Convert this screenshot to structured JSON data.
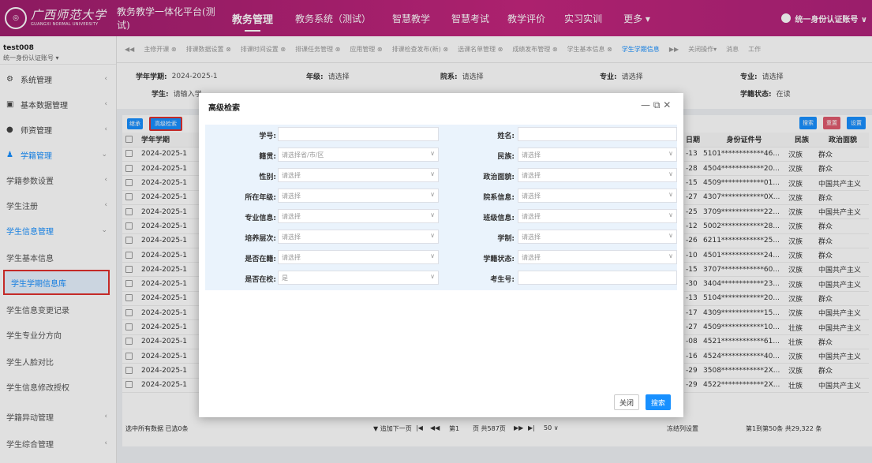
{
  "brand": {
    "name_cn": "广西师范大学",
    "name_en": "GUANGXI NORMAL UNIVERSITY",
    "system": "教务教学一体化平台(测试)"
  },
  "nav": [
    "教务管理",
    "教务系统（测试）",
    "智慧教学",
    "智慧考试",
    "教学评价",
    "实习实训",
    "更多 ▾"
  ],
  "user": "统一身份认证账号 ∨",
  "sidebar": {
    "account": "test008",
    "account_sub": "统一身份认证账号 ▾",
    "items": [
      "系统管理",
      "基本数据管理",
      "师资管理",
      "学籍管理",
      "学籍参数设置",
      "学生注册",
      "学生信息管理",
      "学生基本信息",
      "学生学期信息库",
      "学生信息变更记录",
      "学生专业分方向",
      "学生人脸对比",
      "学生信息修改授权",
      "学籍异动管理",
      "学生综合管理"
    ]
  },
  "tabs": [
    "◀◀",
    "主修开课 ⊗",
    "排课数据设置 ⊗",
    "排课时间设置 ⊗",
    "排课任务管理 ⊗",
    "应用管理 ⊗",
    "排课检查发布(新) ⊗",
    "选课名单管理 ⊗",
    "成绩发布管理 ⊗",
    "学生基本信息 ⊗",
    "学生学期信息",
    "▶▶",
    "关闭操作▾",
    "消息",
    "工作"
  ],
  "filters": {
    "term_label": "学年学期:",
    "term_value": "2024-2025-1",
    "grade_label": "年级:",
    "grade_value": "请选择",
    "dept_label": "院系:",
    "dept_value": "请选择",
    "major_label": "专业:",
    "major_value": "请选择",
    "major2_label": "专业:",
    "major2_value": "请选择",
    "student_label": "学生:",
    "student_value": "请输入学",
    "status_label": "学籍状态:",
    "status_value": "在读"
  },
  "toolbar": {
    "b1": "继承",
    "b2": "高级检索",
    "search": "搜索",
    "reset": "重置",
    "settings": "设置"
  },
  "table": {
    "h_term": "学年学期",
    "h_date": "日期",
    "h_id": "身份证件号",
    "h_nation": "民族",
    "h_party": "政治面貌",
    "rows": [
      [
        "2024-2025-1",
        "-13",
        "5101************46...",
        "汉族",
        "群众"
      ],
      [
        "2024-2025-1",
        "-28",
        "4504************20...",
        "汉族",
        "群众"
      ],
      [
        "2024-2025-1",
        "-15",
        "4509************01...",
        "汉族",
        "中国共产主义"
      ],
      [
        "2024-2025-1",
        "-27",
        "4307************0X...",
        "汉族",
        "群众"
      ],
      [
        "2024-2025-1",
        "-25",
        "3709************22...",
        "汉族",
        "中国共产主义"
      ],
      [
        "2024-2025-1",
        "-12",
        "5002************28...",
        "汉族",
        "群众"
      ],
      [
        "2024-2025-1",
        "-26",
        "6211************25...",
        "汉族",
        "群众"
      ],
      [
        "2024-2025-1",
        "-10",
        "4501************24...",
        "汉族",
        "群众"
      ],
      [
        "2024-2025-1",
        "-15",
        "3707************60...",
        "汉族",
        "中国共产主义"
      ],
      [
        "2024-2025-1",
        "-30",
        "3404************23...",
        "汉族",
        "中国共产主义"
      ],
      [
        "2024-2025-1",
        "-13",
        "5104************20...",
        "汉族",
        "群众"
      ],
      [
        "2024-2025-1",
        "-17",
        "4309************15...",
        "汉族",
        "中国共产主义"
      ],
      [
        "2024-2025-1",
        "-27",
        "4509************10...",
        "壮族",
        "中国共产主义"
      ],
      [
        "2024-2025-1",
        "-08",
        "4521************61...",
        "壮族",
        "群众"
      ],
      [
        "2024-2025-1",
        "-16",
        "4524************40...",
        "汉族",
        "中国共产主义"
      ],
      [
        "2024-2025-1",
        "-29",
        "3508************2X...",
        "汉族",
        "群众"
      ],
      [
        "2024-2025-1",
        "-29",
        "4522************2X...",
        "壮族",
        "中国共产主义"
      ]
    ]
  },
  "pager": {
    "select_all": "选中所有数据 已选0条",
    "load_next": "▼ 追加下一页",
    "first": "|◀",
    "prev": "◀◀",
    "page_pre": "第1",
    "page_total": "页 共587页",
    "next": "▶▶",
    "last": "▶|",
    "size": "50 ∨",
    "freeze": "冻结列设置",
    "summary": "第1到第50条 共29,322 条"
  },
  "modal": {
    "title": "高级检索",
    "controls": "— ⧉ ✕",
    "fields": [
      {
        "label": "学号:",
        "value": ""
      },
      {
        "label": "姓名:",
        "value": ""
      },
      {
        "label": "籍贯:",
        "value": "请选择省/市/区"
      },
      {
        "label": "民族:",
        "value": "请选择"
      },
      {
        "label": "性别:",
        "value": "请选择"
      },
      {
        "label": "政治面貌:",
        "value": "请选择"
      },
      {
        "label": "所在年级:",
        "value": "请选择"
      },
      {
        "label": "院系信息:",
        "value": "请选择"
      },
      {
        "label": "专业信息:",
        "value": "请选择"
      },
      {
        "label": "班级信息:",
        "value": "请选择"
      },
      {
        "label": "培养层次:",
        "value": "请选择"
      },
      {
        "label": "学制:",
        "value": "请选择"
      },
      {
        "label": "是否在籍:",
        "value": "请选择"
      },
      {
        "label": "学籍状态:",
        "value": "请选择"
      },
      {
        "label": "是否在校:",
        "value": "是"
      },
      {
        "label": "考生号:",
        "value": ""
      }
    ],
    "close": "关闭",
    "search": "搜索"
  }
}
